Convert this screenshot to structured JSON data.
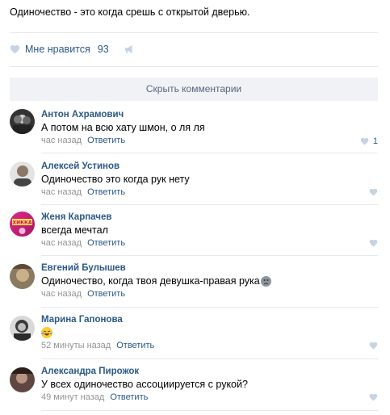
{
  "post": {
    "text": "Одиночество - это когда срешь с открытой дверью.",
    "like_label": "Мне нравится",
    "like_count": "93"
  },
  "hide_comments": "Скрыть комментарии",
  "reply_label": "Ответить",
  "colors": {
    "link": "#2a5885",
    "meta": "#939393",
    "heart": "#c5d3e2",
    "bar_bg": "#f0f2f5",
    "separator": "#e7e8ec"
  },
  "comments": [
    {
      "author": "Антон Ахрамович",
      "text": "А потом на всю хату шмон, о ля ля",
      "time": "час назад",
      "likes": "1"
    },
    {
      "author": "Алексей Устинов",
      "text": "Одиночество это когда рук нету",
      "time": "час назад",
      "likes": ""
    },
    {
      "author": "Женя Карпачев",
      "text": "всегда мечтал",
      "time": "час назад",
      "likes": "",
      "avatar_text": "ХИККА"
    },
    {
      "author": "Евгений Булышев",
      "text": "Одиночество, когда твоя девушка-правая рука",
      "time": "час назад",
      "likes": "",
      "emoji": "sad-face-emoji"
    },
    {
      "author": "Марина Гапонова",
      "text": "",
      "time": "52 минуты назад",
      "likes": "",
      "emoji": "laughing-crying-emoji"
    },
    {
      "author": "Александра Пирожок",
      "text": "У всех одиночество ассоциируется с рукой?",
      "time": "49 минут назад",
      "likes": ""
    }
  ]
}
